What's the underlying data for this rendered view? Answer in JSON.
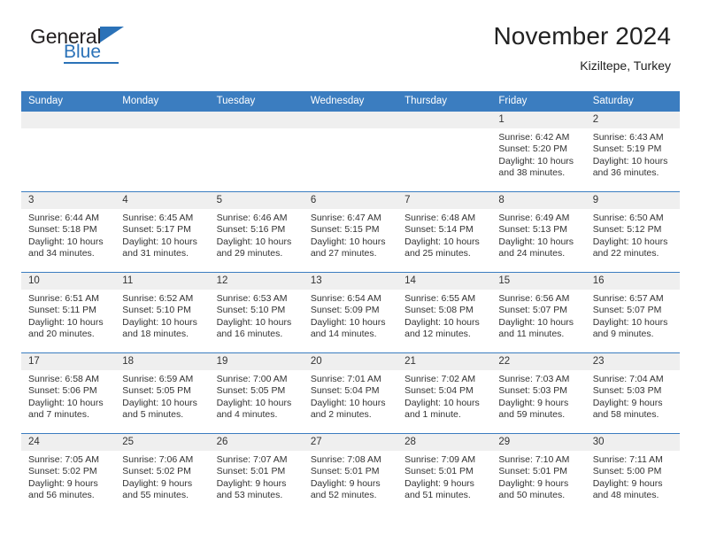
{
  "brand": {
    "name_part1": "General",
    "name_part2": "Blue",
    "flag_icon": "triangle-flag-icon"
  },
  "header": {
    "month_title": "November 2024",
    "location": "Kiziltepe, Turkey"
  },
  "colors": {
    "header_blue": "#3b7dc0",
    "brand_blue": "#2b72b8",
    "daynum_bg": "#efefef",
    "text": "#333333"
  },
  "calendar": {
    "weekday_headers": [
      "Sunday",
      "Monday",
      "Tuesday",
      "Wednesday",
      "Thursday",
      "Friday",
      "Saturday"
    ],
    "weeks": [
      [
        {
          "day": "",
          "empty": true
        },
        {
          "day": "",
          "empty": true
        },
        {
          "day": "",
          "empty": true
        },
        {
          "day": "",
          "empty": true
        },
        {
          "day": "",
          "empty": true
        },
        {
          "day": "1",
          "sunrise": "Sunrise: 6:42 AM",
          "sunset": "Sunset: 5:20 PM",
          "daylight1": "Daylight: 10 hours",
          "daylight2": "and 38 minutes."
        },
        {
          "day": "2",
          "sunrise": "Sunrise: 6:43 AM",
          "sunset": "Sunset: 5:19 PM",
          "daylight1": "Daylight: 10 hours",
          "daylight2": "and 36 minutes."
        }
      ],
      [
        {
          "day": "3",
          "sunrise": "Sunrise: 6:44 AM",
          "sunset": "Sunset: 5:18 PM",
          "daylight1": "Daylight: 10 hours",
          "daylight2": "and 34 minutes."
        },
        {
          "day": "4",
          "sunrise": "Sunrise: 6:45 AM",
          "sunset": "Sunset: 5:17 PM",
          "daylight1": "Daylight: 10 hours",
          "daylight2": "and 31 minutes."
        },
        {
          "day": "5",
          "sunrise": "Sunrise: 6:46 AM",
          "sunset": "Sunset: 5:16 PM",
          "daylight1": "Daylight: 10 hours",
          "daylight2": "and 29 minutes."
        },
        {
          "day": "6",
          "sunrise": "Sunrise: 6:47 AM",
          "sunset": "Sunset: 5:15 PM",
          "daylight1": "Daylight: 10 hours",
          "daylight2": "and 27 minutes."
        },
        {
          "day": "7",
          "sunrise": "Sunrise: 6:48 AM",
          "sunset": "Sunset: 5:14 PM",
          "daylight1": "Daylight: 10 hours",
          "daylight2": "and 25 minutes."
        },
        {
          "day": "8",
          "sunrise": "Sunrise: 6:49 AM",
          "sunset": "Sunset: 5:13 PM",
          "daylight1": "Daylight: 10 hours",
          "daylight2": "and 24 minutes."
        },
        {
          "day": "9",
          "sunrise": "Sunrise: 6:50 AM",
          "sunset": "Sunset: 5:12 PM",
          "daylight1": "Daylight: 10 hours",
          "daylight2": "and 22 minutes."
        }
      ],
      [
        {
          "day": "10",
          "sunrise": "Sunrise: 6:51 AM",
          "sunset": "Sunset: 5:11 PM",
          "daylight1": "Daylight: 10 hours",
          "daylight2": "and 20 minutes."
        },
        {
          "day": "11",
          "sunrise": "Sunrise: 6:52 AM",
          "sunset": "Sunset: 5:10 PM",
          "daylight1": "Daylight: 10 hours",
          "daylight2": "and 18 minutes."
        },
        {
          "day": "12",
          "sunrise": "Sunrise: 6:53 AM",
          "sunset": "Sunset: 5:10 PM",
          "daylight1": "Daylight: 10 hours",
          "daylight2": "and 16 minutes."
        },
        {
          "day": "13",
          "sunrise": "Sunrise: 6:54 AM",
          "sunset": "Sunset: 5:09 PM",
          "daylight1": "Daylight: 10 hours",
          "daylight2": "and 14 minutes."
        },
        {
          "day": "14",
          "sunrise": "Sunrise: 6:55 AM",
          "sunset": "Sunset: 5:08 PM",
          "daylight1": "Daylight: 10 hours",
          "daylight2": "and 12 minutes."
        },
        {
          "day": "15",
          "sunrise": "Sunrise: 6:56 AM",
          "sunset": "Sunset: 5:07 PM",
          "daylight1": "Daylight: 10 hours",
          "daylight2": "and 11 minutes."
        },
        {
          "day": "16",
          "sunrise": "Sunrise: 6:57 AM",
          "sunset": "Sunset: 5:07 PM",
          "daylight1": "Daylight: 10 hours",
          "daylight2": "and 9 minutes."
        }
      ],
      [
        {
          "day": "17",
          "sunrise": "Sunrise: 6:58 AM",
          "sunset": "Sunset: 5:06 PM",
          "daylight1": "Daylight: 10 hours",
          "daylight2": "and 7 minutes."
        },
        {
          "day": "18",
          "sunrise": "Sunrise: 6:59 AM",
          "sunset": "Sunset: 5:05 PM",
          "daylight1": "Daylight: 10 hours",
          "daylight2": "and 5 minutes."
        },
        {
          "day": "19",
          "sunrise": "Sunrise: 7:00 AM",
          "sunset": "Sunset: 5:05 PM",
          "daylight1": "Daylight: 10 hours",
          "daylight2": "and 4 minutes."
        },
        {
          "day": "20",
          "sunrise": "Sunrise: 7:01 AM",
          "sunset": "Sunset: 5:04 PM",
          "daylight1": "Daylight: 10 hours",
          "daylight2": "and 2 minutes."
        },
        {
          "day": "21",
          "sunrise": "Sunrise: 7:02 AM",
          "sunset": "Sunset: 5:04 PM",
          "daylight1": "Daylight: 10 hours",
          "daylight2": "and 1 minute."
        },
        {
          "day": "22",
          "sunrise": "Sunrise: 7:03 AM",
          "sunset": "Sunset: 5:03 PM",
          "daylight1": "Daylight: 9 hours",
          "daylight2": "and 59 minutes."
        },
        {
          "day": "23",
          "sunrise": "Sunrise: 7:04 AM",
          "sunset": "Sunset: 5:03 PM",
          "daylight1": "Daylight: 9 hours",
          "daylight2": "and 58 minutes."
        }
      ],
      [
        {
          "day": "24",
          "sunrise": "Sunrise: 7:05 AM",
          "sunset": "Sunset: 5:02 PM",
          "daylight1": "Daylight: 9 hours",
          "daylight2": "and 56 minutes."
        },
        {
          "day": "25",
          "sunrise": "Sunrise: 7:06 AM",
          "sunset": "Sunset: 5:02 PM",
          "daylight1": "Daylight: 9 hours",
          "daylight2": "and 55 minutes."
        },
        {
          "day": "26",
          "sunrise": "Sunrise: 7:07 AM",
          "sunset": "Sunset: 5:01 PM",
          "daylight1": "Daylight: 9 hours",
          "daylight2": "and 53 minutes."
        },
        {
          "day": "27",
          "sunrise": "Sunrise: 7:08 AM",
          "sunset": "Sunset: 5:01 PM",
          "daylight1": "Daylight: 9 hours",
          "daylight2": "and 52 minutes."
        },
        {
          "day": "28",
          "sunrise": "Sunrise: 7:09 AM",
          "sunset": "Sunset: 5:01 PM",
          "daylight1": "Daylight: 9 hours",
          "daylight2": "and 51 minutes."
        },
        {
          "day": "29",
          "sunrise": "Sunrise: 7:10 AM",
          "sunset": "Sunset: 5:01 PM",
          "daylight1": "Daylight: 9 hours",
          "daylight2": "and 50 minutes."
        },
        {
          "day": "30",
          "sunrise": "Sunrise: 7:11 AM",
          "sunset": "Sunset: 5:00 PM",
          "daylight1": "Daylight: 9 hours",
          "daylight2": "and 48 minutes."
        }
      ]
    ]
  }
}
